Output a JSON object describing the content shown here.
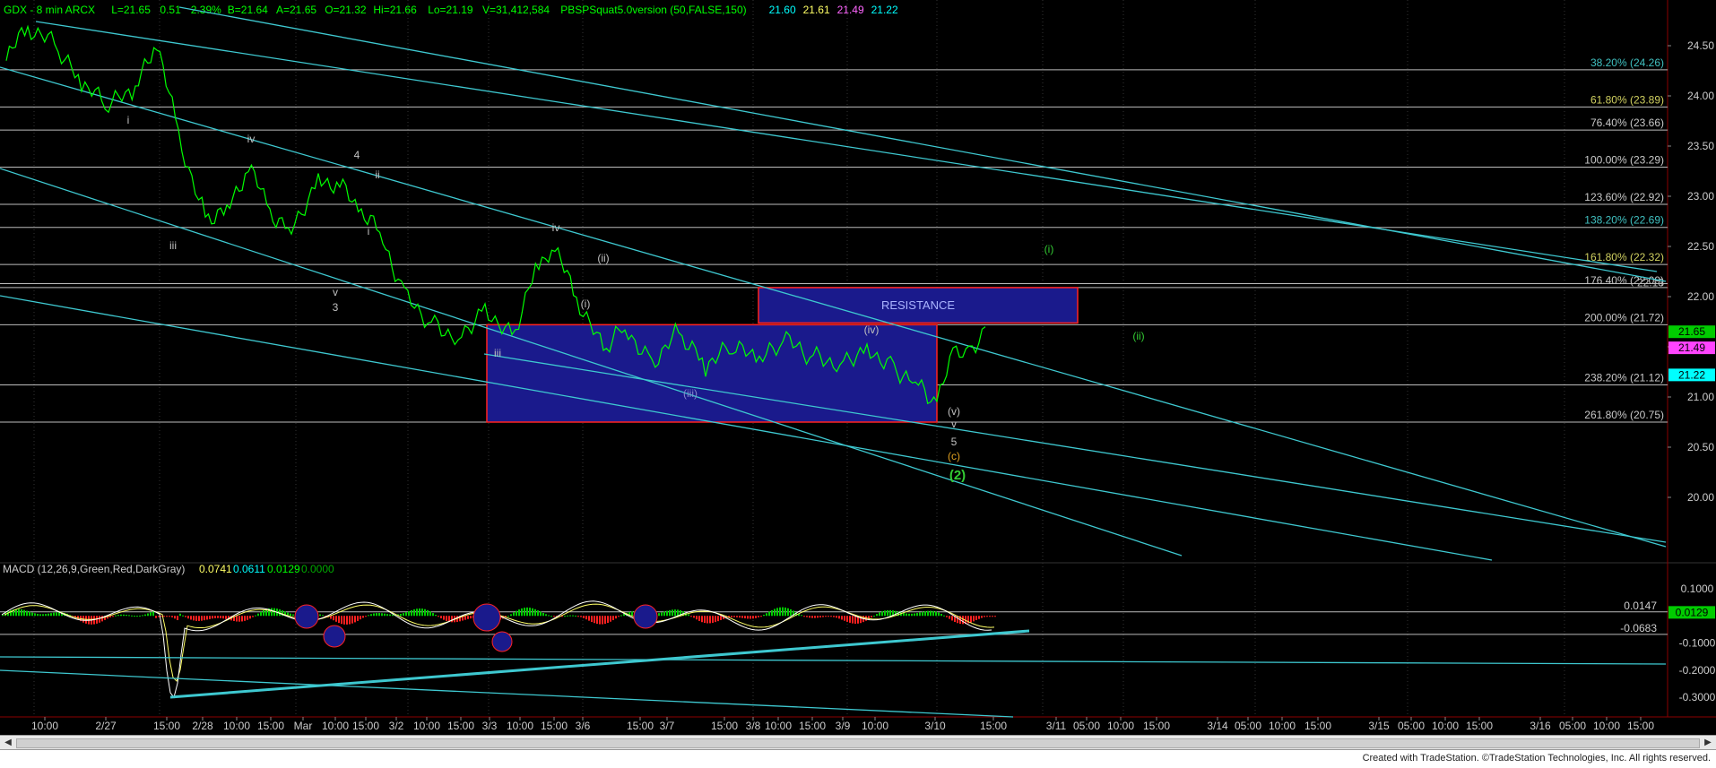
{
  "header": {
    "symbol": "GDX - 8 min  ARCX",
    "last": "L=21.65",
    "change": "0.51",
    "change_pct": "2.39%",
    "bid": "B=21.64",
    "ask": "A=21.65",
    "open": "O=21.32",
    "high": "Hi=21.66",
    "low": "Lo=21.19",
    "volume": "V=31,412,584",
    "study": "PBSPSquat5.0version (50,FALSE,150)",
    "study_values": [
      "21.60",
      "21.61",
      "21.49",
      "21.22"
    ],
    "study_colors": [
      "#00ffff",
      "#ffff66",
      "#ff66ff",
      "#00ffff"
    ]
  },
  "macd_header": {
    "label": "MACD (12,26,9,Green,Red,DarkGray)",
    "values": [
      "0.0741",
      "0.0611",
      "0.0129",
      "0.0000"
    ],
    "colors": [
      "#ffff66",
      "#00ffff",
      "#00ff00",
      "#00aa00"
    ]
  },
  "colors": {
    "price": "#00ff00",
    "trendline": "#3ec8d0",
    "fib": "#c8c8c8",
    "wave_label": "#c0c0c0",
    "box": "#1a1a8c",
    "box_border": "#ff2222",
    "macd_signal": "#ffff66",
    "macd_line": "#ffffff"
  },
  "fib_levels": [
    {
      "label": "38.20% (24.26)",
      "price": 24.26,
      "color": "#40c0c0"
    },
    {
      "label": "61.80% (23.89)",
      "price": 23.89,
      "color": "#d0d060"
    },
    {
      "label": "76.40% (23.66)",
      "price": 23.66,
      "color": "#c8c8c8"
    },
    {
      "label": "100.00% (23.29)",
      "price": 23.29,
      "color": "#c8c8c8"
    },
    {
      "label": "123.60% (22.92)",
      "price": 22.92,
      "color": "#c8c8c8"
    },
    {
      "label": "138.20% (22.69)",
      "price": 22.69,
      "color": "#40c0c0"
    },
    {
      "label": "161.80% (22.32)",
      "price": 22.32,
      "color": "#d0d060"
    },
    {
      "label": "176.40% (22.09)",
      "price": 22.09,
      "color": "#c8c8c8"
    },
    {
      "label": "200.00% (21.72)",
      "price": 21.72,
      "color": "#c8c8c8"
    },
    {
      "label": "238.20% (21.12)",
      "price": 21.12,
      "color": "#c8c8c8"
    },
    {
      "label": "261.80% (20.75)",
      "price": 20.75,
      "color": "#c8c8c8"
    }
  ],
  "extra_level": {
    "label": "22.13",
    "price": 22.13
  },
  "resistance_label": "RESISTANCE",
  "price_axis": [
    "24.50",
    "24.00",
    "23.50",
    "23.00",
    "22.50",
    "22.00",
    "21.50",
    "21.00",
    "20.50",
    "20.00"
  ],
  "price_tags": [
    {
      "text": "21.65",
      "price": 21.65,
      "bg": "#00cc00",
      "fg": "#000"
    },
    {
      "text": "21.49",
      "price": 21.49,
      "bg": "#ff44ff",
      "fg": "#000"
    },
    {
      "text": "21.22",
      "price": 21.22,
      "bg": "#00ffff",
      "fg": "#000"
    }
  ],
  "macd_axis": [
    "0.1000",
    "-0.1000",
    "-0.2000",
    "-0.3000"
  ],
  "macd_levels": [
    {
      "label": "0.0147",
      "value": 0.0147
    },
    {
      "label": "-0.0683",
      "value": -0.0683
    }
  ],
  "macd_tag": {
    "text": "0.0129",
    "value": 0.0129,
    "bg": "#00cc00"
  },
  "time_axis": [
    "10:00",
    "2/27",
    "15:00",
    "2/28",
    "10:00",
    "15:00",
    "Mar",
    "10:00",
    "15:00",
    "3/2",
    "10:00",
    "15:00",
    "3/3",
    "10:00",
    "15:00",
    "3/6",
    "15:00",
    "3/7",
    "15:00",
    "3/8",
    "10:00",
    "15:00",
    "3/9",
    "10:00",
    "3/10",
    "15:00",
    "3/11",
    "05:00",
    "10:00",
    "15:00",
    "3/14",
    "05:00",
    "10:00",
    "15:00",
    "3/15",
    "05:00",
    "10:00",
    "15:00",
    "3/16",
    "05:00",
    "10:00",
    "15:00"
  ],
  "wave_labels": [
    {
      "text": "i",
      "color": "#c0c0c0"
    },
    {
      "text": "iii",
      "color": "#c0c0c0"
    },
    {
      "text": "iv",
      "color": "#c0c0c0"
    },
    {
      "text": "v",
      "color": "#c0c0c0"
    },
    {
      "text": "3",
      "color": "#c0c0c0"
    },
    {
      "text": "4",
      "color": "#c0c0c0"
    },
    {
      "text": "ii",
      "color": "#c0c0c0"
    },
    {
      "text": "i",
      "color": "#c0c0c0"
    },
    {
      "text": "iv",
      "color": "#c0c0c0"
    },
    {
      "text": "(ii)",
      "color": "#c0c0c0"
    },
    {
      "text": "(i)",
      "color": "#c0c0c0"
    },
    {
      "text": "iii",
      "color": "#c0c0c0"
    },
    {
      "text": "(iii)",
      "color": "#8888cc"
    },
    {
      "text": "(iv)",
      "color": "#c0c0c0"
    },
    {
      "text": "(v)",
      "color": "#c0c0c0"
    },
    {
      "text": "v",
      "color": "#c0c0c0"
    },
    {
      "text": "5",
      "color": "#c0c0c0"
    },
    {
      "text": "(c)",
      "color": "#e0a020"
    },
    {
      "text": "(2)",
      "color": "#33cc33"
    },
    {
      "text": "(i)",
      "color": "#33cc33"
    },
    {
      "text": "(ii)",
      "color": "#33cc33"
    }
  ],
  "footer": "Created with TradeStation. ©TradeStation Technologies, Inc. All rights reserved.",
  "chart_data": {
    "type": "line",
    "title": "",
    "ylim": [
      19.6,
      24.8
    ],
    "macd_ylim": [
      -0.33,
      0.16
    ],
    "series": [
      {
        "name": "GDX",
        "x": [
          0,
          20,
          45,
          70,
          95,
          120,
          140,
          160,
          185,
          205,
          225,
          245,
          265,
          290,
          310,
          330,
          350,
          370,
          395,
          420,
          445,
          470,
          495,
          510,
          530,
          555,
          575,
          600,
          625,
          650,
          675,
          700,
          725,
          750,
          775,
          800,
          825,
          845,
          865,
          880,
          895,
          910
        ],
        "values": [
          24.35,
          24.7,
          24.5,
          24.1,
          23.9,
          24.05,
          24.55,
          23.6,
          22.8,
          22.85,
          23.3,
          22.85,
          22.65,
          23.2,
          23.1,
          22.85,
          22.6,
          22.0,
          21.75,
          21.6,
          21.9,
          21.6,
          22.35,
          22.45,
          22.0,
          21.45,
          21.7,
          21.35,
          21.65,
          21.3,
          21.5,
          21.35,
          21.55,
          21.4,
          21.35,
          21.5,
          21.3,
          21.15,
          20.95,
          21.4,
          21.45,
          21.7
        ]
      }
    ]
  }
}
